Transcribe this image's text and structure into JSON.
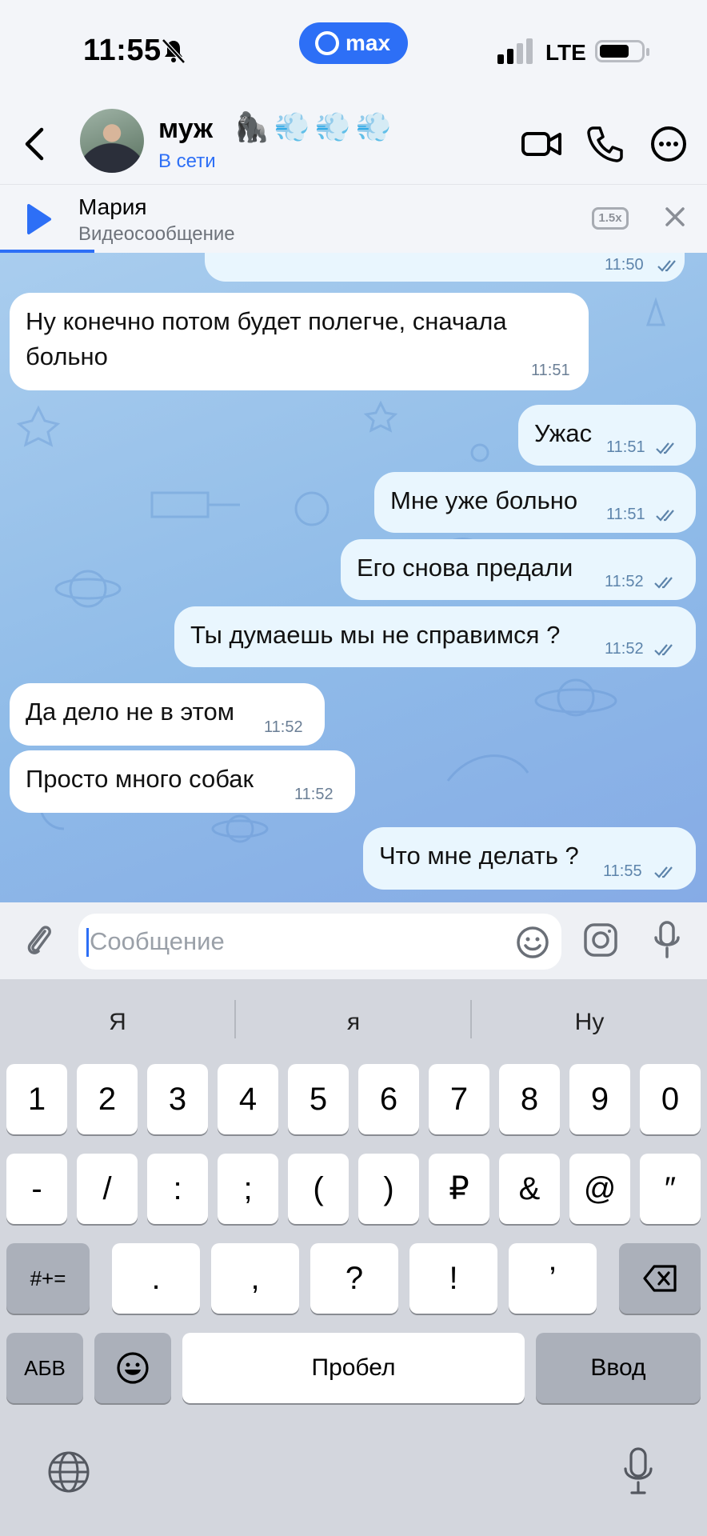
{
  "status_bar": {
    "time": "11:55",
    "app_pill": "max",
    "network": "LTE"
  },
  "chat_header": {
    "name": "муж",
    "name_emojis": "🦍💨💨💨",
    "presence": "В сети"
  },
  "pinned": {
    "sender": "Мария",
    "subtitle": "Видеосообщение",
    "speed": "1.5x"
  },
  "messages": [
    {
      "direction": "outgoing",
      "text": "",
      "time": "11:50",
      "read": true,
      "partial": true
    },
    {
      "direction": "incoming",
      "text": "Ну конечно потом будет полегче, сначала",
      "text2": "больно",
      "time": "11:51"
    },
    {
      "direction": "outgoing",
      "text": "Ужас",
      "time": "11:51",
      "read": true
    },
    {
      "direction": "outgoing",
      "text": "Мне уже больно",
      "time": "11:51",
      "read": true
    },
    {
      "direction": "outgoing",
      "text": "Его снова предали",
      "time": "11:52",
      "read": true
    },
    {
      "direction": "outgoing",
      "text": "Ты думаешь мы не справимся ?",
      "time": "11:52",
      "read": true
    },
    {
      "direction": "incoming",
      "text": "Да дело не в этом",
      "time": "11:52"
    },
    {
      "direction": "incoming",
      "text": "Просто много собак",
      "time": "11:52"
    },
    {
      "direction": "outgoing",
      "text": "Что мне делать ?",
      "time": "11:55",
      "read": true
    }
  ],
  "composer": {
    "placeholder": "Сообщение",
    "value": ""
  },
  "keyboard": {
    "suggestions": [
      "Я",
      "я",
      "Ну"
    ],
    "row1": [
      "1",
      "2",
      "3",
      "4",
      "5",
      "6",
      "7",
      "8",
      "9",
      "0"
    ],
    "row2": [
      "-",
      "/",
      ":",
      ";",
      "(",
      ")",
      "₽",
      "&",
      "@",
      "″"
    ],
    "row3": [
      ".",
      ",",
      "?",
      "!",
      "’"
    ],
    "symbols_key": "#+=",
    "abc_key": "АБВ",
    "space_key": "Пробел",
    "return_key": "Ввод"
  }
}
